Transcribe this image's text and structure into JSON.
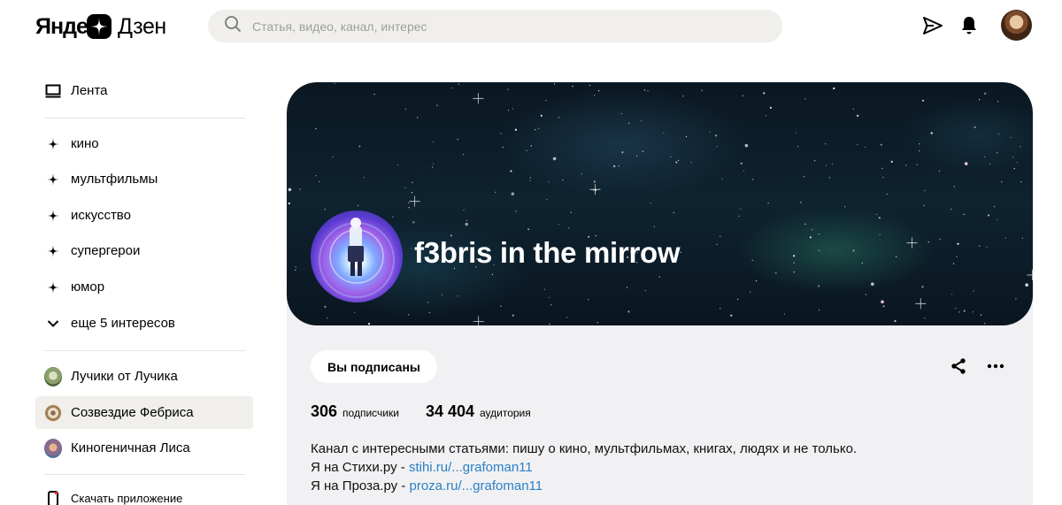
{
  "header": {
    "logo_part1": "Яндекс",
    "logo_part2": "Дзен",
    "search_placeholder": "Статья, видео, канал, интерес"
  },
  "sidebar": {
    "feed": "Лента",
    "interests": [
      "кино",
      "мультфильмы",
      "искусство",
      "супергерои",
      "юмор"
    ],
    "more_interests": "еще 5 интересов",
    "channels": [
      "Лучики от Лучика",
      "Созвездие Фебриса",
      "Киногеничная Лиса"
    ],
    "download": "Скачать приложение"
  },
  "channel": {
    "title": "f3bris in the mirrow",
    "subscribe_label": "Вы подписаны",
    "subscribers_count": "306",
    "subscribers_label": "подписчики",
    "audience_count": "34 404",
    "audience_label": "аудитория",
    "description": "Канал с интересными статьями: пишу о кино, мультфильмах, книгах, людях и не только.",
    "link1_prefix": "Я на Стихи.ру - ",
    "link1_text": "stihi.ru/...grafoman11",
    "link2_prefix": "Я на Проза.ру - ",
    "link2_text": "proza.ru/...grafoman11"
  },
  "colors": {
    "accent_link": "#2a7fc4",
    "active_item_bg": "#f0efeb",
    "card_bg": "#f1f1f4"
  }
}
